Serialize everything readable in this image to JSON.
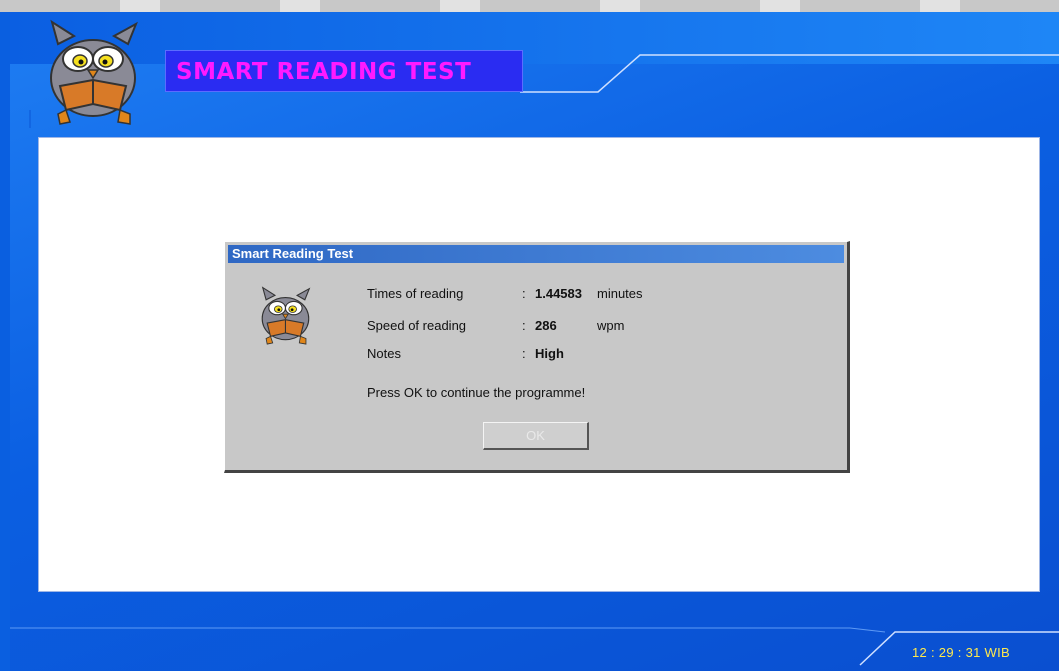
{
  "app": {
    "banner_title": "SMART READING TEST"
  },
  "dialog": {
    "title": "Smart Reading Test",
    "rows": [
      {
        "label": "Times of reading",
        "colon": ":",
        "value": "1.44583",
        "unit": "minutes"
      },
      {
        "label": "Speed of reading",
        "colon": ":",
        "value": "286",
        "unit": "wpm"
      },
      {
        "label": "Notes",
        "colon": ":",
        "value": "High",
        "unit": ""
      }
    ],
    "message": "Press OK to continue the programme!",
    "ok_label": "OK"
  },
  "status": {
    "clock": "12 : 29 : 31  WIB"
  },
  "colors": {
    "background": "#0b5fe2",
    "banner": "#2a2cf2",
    "banner_text": "#ff1aff",
    "dialog_title_bar": "#2f68c4",
    "clock_text": "#ffe94d"
  },
  "icons": [
    "owl-reading-icon",
    "owl-dialog-icon"
  ]
}
